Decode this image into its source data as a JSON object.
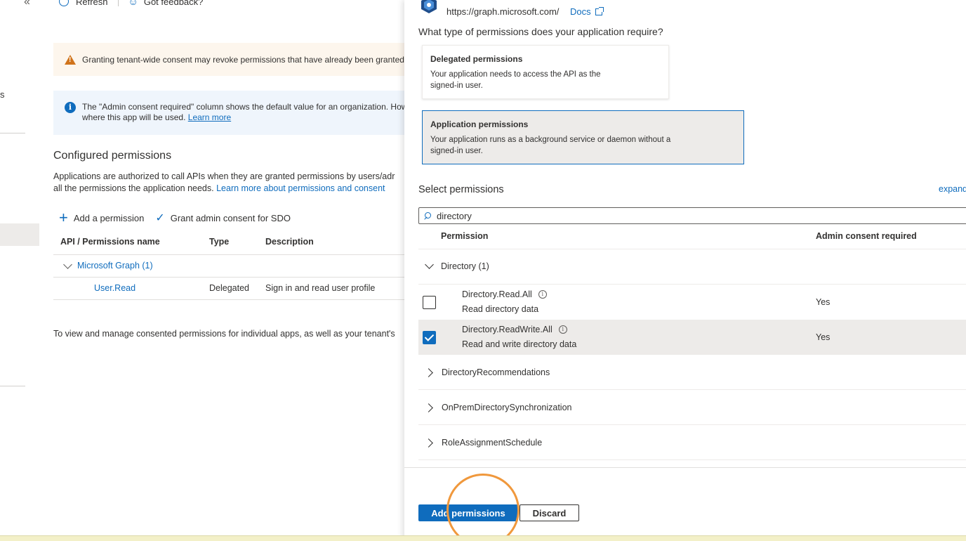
{
  "nav": {
    "collapse_glyph": "«",
    "fragment_text": "s"
  },
  "toolbar": {
    "refresh_label": "Refresh",
    "feedback_label": "Got feedback?"
  },
  "banners": {
    "warning_text": "Granting tenant-wide consent may revoke permissions that have already been granted",
    "info_line1": "The \"Admin consent required\" column shows the default value for an organization. How",
    "info_line2": "where this app will be used.",
    "info_link": "Learn more"
  },
  "configured": {
    "title": "Configured permissions",
    "desc_line1": "Applications are authorized to call APIs when they are granted permissions by users/adr",
    "desc_line2": "all the permissions the application needs.",
    "desc_link": "Learn more about permissions and consent",
    "add_permission": "Add a permission",
    "grant_consent": "Grant admin consent for SDO",
    "columns": {
      "api": "API / Permissions name",
      "type": "Type",
      "description": "Description"
    },
    "group_label": "Microsoft Graph (1)",
    "rows": [
      {
        "name": "User.Read",
        "type": "Delegated",
        "description": "Sign in and read user profile"
      }
    ],
    "bottom_note": "To view and manage consented permissions for individual apps, as well as your tenant's"
  },
  "panel": {
    "api_url": "https://graph.microsoft.com/",
    "docs_label": "Docs",
    "question": "What type of permissions does your application require?",
    "delegated": {
      "title": "Delegated permissions",
      "desc_line1": "Your application needs to access the API as the",
      "desc_line2": "signed-in user."
    },
    "application": {
      "title": "Application permissions",
      "desc_line1": "Your application runs as a background service or daemon without a",
      "desc_line2": "signed-in user."
    },
    "select_title": "Select permissions",
    "expand_label": "expand",
    "search_value": "directory",
    "columns": {
      "permission": "Permission",
      "admin_consent": "Admin consent required"
    },
    "group_label": "Directory (1)",
    "permissions": [
      {
        "name": "Directory.Read.All",
        "description": "Read directory data",
        "admin_consent": "Yes",
        "checked": false
      },
      {
        "name": "Directory.ReadWrite.All",
        "description": "Read and write directory data",
        "admin_consent": "Yes",
        "checked": true
      }
    ],
    "collapsed_groups": [
      "DirectoryRecommendations",
      "OnPremDirectorySynchronization",
      "RoleAssignmentSchedule"
    ],
    "add_button": "Add permissions",
    "discard_button": "Discard"
  },
  "colors": {
    "accent": "#0f6cbd",
    "warning": "#d0731a",
    "highlight_ring": "#f0983c"
  }
}
